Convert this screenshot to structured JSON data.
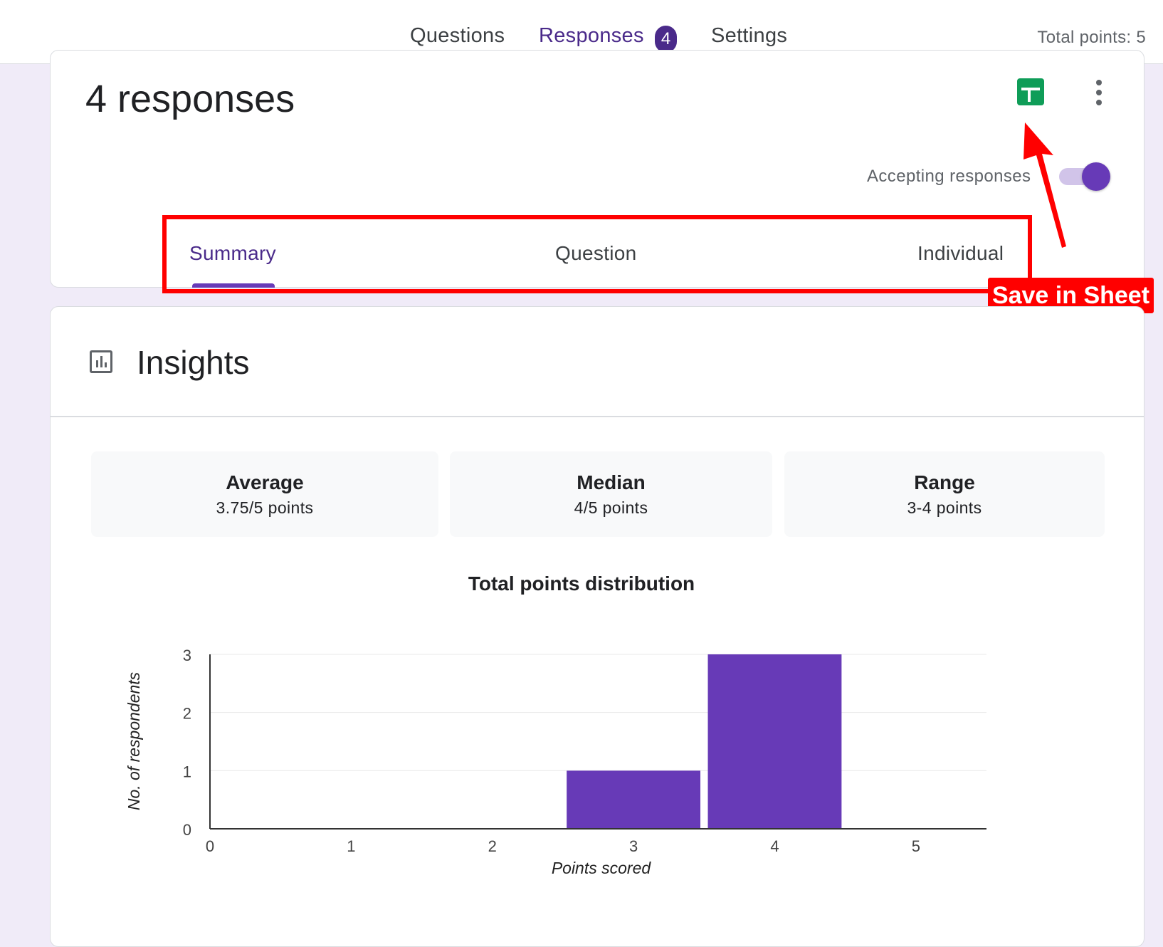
{
  "top_tabs": {
    "questions": "Questions",
    "responses": "Responses",
    "responses_badge": "4",
    "settings": "Settings",
    "total_points": "Total points: 5"
  },
  "responses_card": {
    "title": "4 responses",
    "accepting_label": "Accepting responses",
    "accepting_on": true,
    "sub_tabs": {
      "summary": "Summary",
      "question": "Question",
      "individual": "Individual"
    }
  },
  "annotation": {
    "label": "Save in Sheet",
    "color": "#ff0000"
  },
  "insights": {
    "title": "Insights",
    "stats": [
      {
        "label": "Average",
        "value": "3.75/5 points"
      },
      {
        "label": "Median",
        "value": "4/5 points"
      },
      {
        "label": "Range",
        "value": "3-4 points"
      }
    ]
  },
  "icons": {
    "sheets": "google-sheets-icon",
    "more": "more-vert-icon",
    "insights": "bar-chart-icon"
  },
  "colors": {
    "accent": "#673ab7",
    "accent_dark": "#4a2a8a",
    "sheets_green": "#0f9d58",
    "background": "#f0ebf8"
  },
  "chart_data": {
    "type": "bar",
    "title": "Total points distribution",
    "xlabel": "Points scored",
    "ylabel": "No. of respondents",
    "x": [
      0,
      1,
      2,
      3,
      4,
      5
    ],
    "values": [
      0,
      0,
      0,
      1,
      3,
      0
    ],
    "xlim": [
      0,
      5.5
    ],
    "ylim": [
      0,
      3
    ],
    "yticks": [
      0,
      1,
      2,
      3
    ],
    "grid": true,
    "bar_color": "#673ab7"
  }
}
